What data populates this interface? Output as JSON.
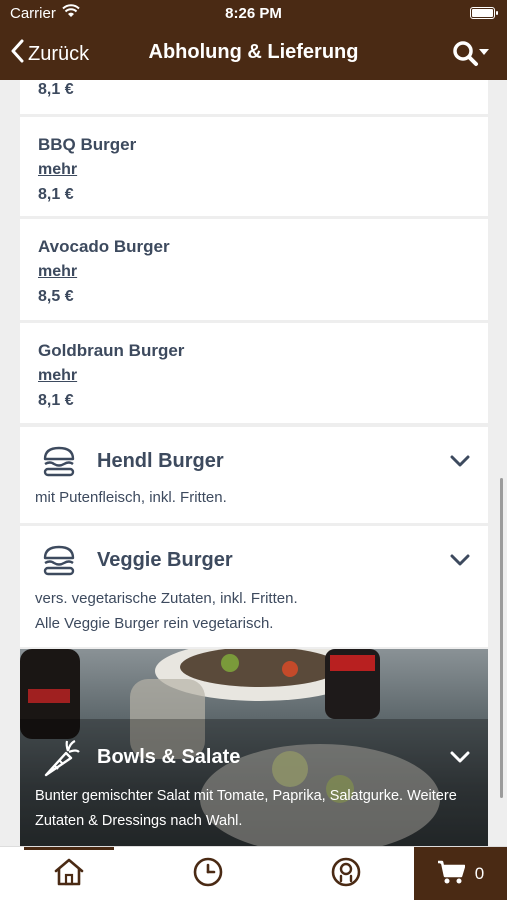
{
  "status_bar": {
    "carrier": "Carrier",
    "time": "8:26 PM"
  },
  "nav": {
    "back_label": "Zurück",
    "title": "Abholung & Lieferung"
  },
  "partial_item": {
    "price": "8,1 €"
  },
  "items": [
    {
      "name": "BBQ Burger",
      "more": "mehr",
      "price": "8,1 €"
    },
    {
      "name": "Avocado Burger",
      "more": "mehr",
      "price": "8,5 €"
    },
    {
      "name": "Goldbraun Burger",
      "more": "mehr",
      "price": "8,1 €"
    }
  ],
  "categories": [
    {
      "title": "Hendl Burger",
      "desc_lines": [
        "mit Putenfleisch, inkl. Fritten."
      ]
    },
    {
      "title": "Veggie Burger",
      "desc_lines": [
        "vers. vegetarische Zutaten, inkl. Fritten.",
        "Alle Veggie Burger rein vegetarisch."
      ]
    },
    {
      "title": "Bowls & Salate",
      "desc_lines": [
        "Bunter gemischter Salat mit Tomate, Paprika, Salatgurke. Weitere",
        "Zutaten & Dressings nach Wahl."
      ]
    }
  ],
  "tabs": {
    "cart_count": "0"
  },
  "colors": {
    "brand": "#4a2a14",
    "text": "#3d4a5e"
  }
}
